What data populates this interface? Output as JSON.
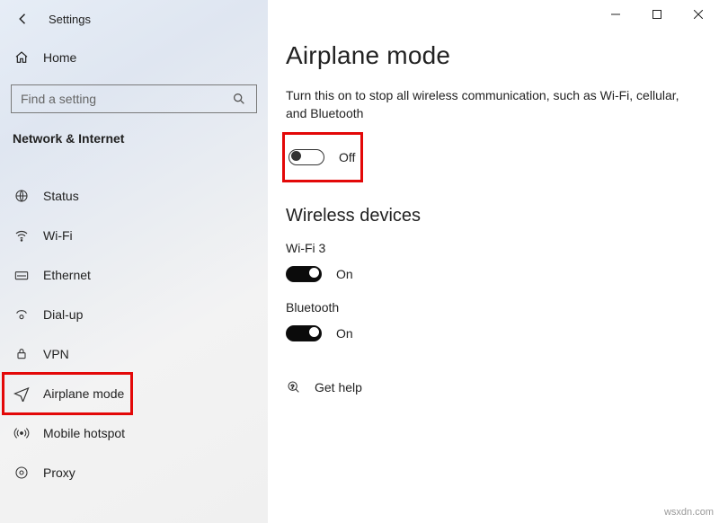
{
  "appTitle": "Settings",
  "home": "Home",
  "searchPlaceholder": "Find a setting",
  "category": "Network & Internet",
  "nav": {
    "status": "Status",
    "wifi": "Wi-Fi",
    "ethernet": "Ethernet",
    "dialup": "Dial-up",
    "vpn": "VPN",
    "airplane": "Airplane mode",
    "hotspot": "Mobile hotspot",
    "proxy": "Proxy"
  },
  "page": {
    "title": "Airplane mode",
    "desc": "Turn this on to stop all wireless communication, such as Wi-Fi, cellular, and Bluetooth",
    "mainToggleState": "Off",
    "wirelessHeader": "Wireless devices",
    "wifiLabel": "Wi-Fi 3",
    "wifiState": "On",
    "btLabel": "Bluetooth",
    "btState": "On",
    "help": "Get help"
  },
  "watermark": "wsxdn.com"
}
